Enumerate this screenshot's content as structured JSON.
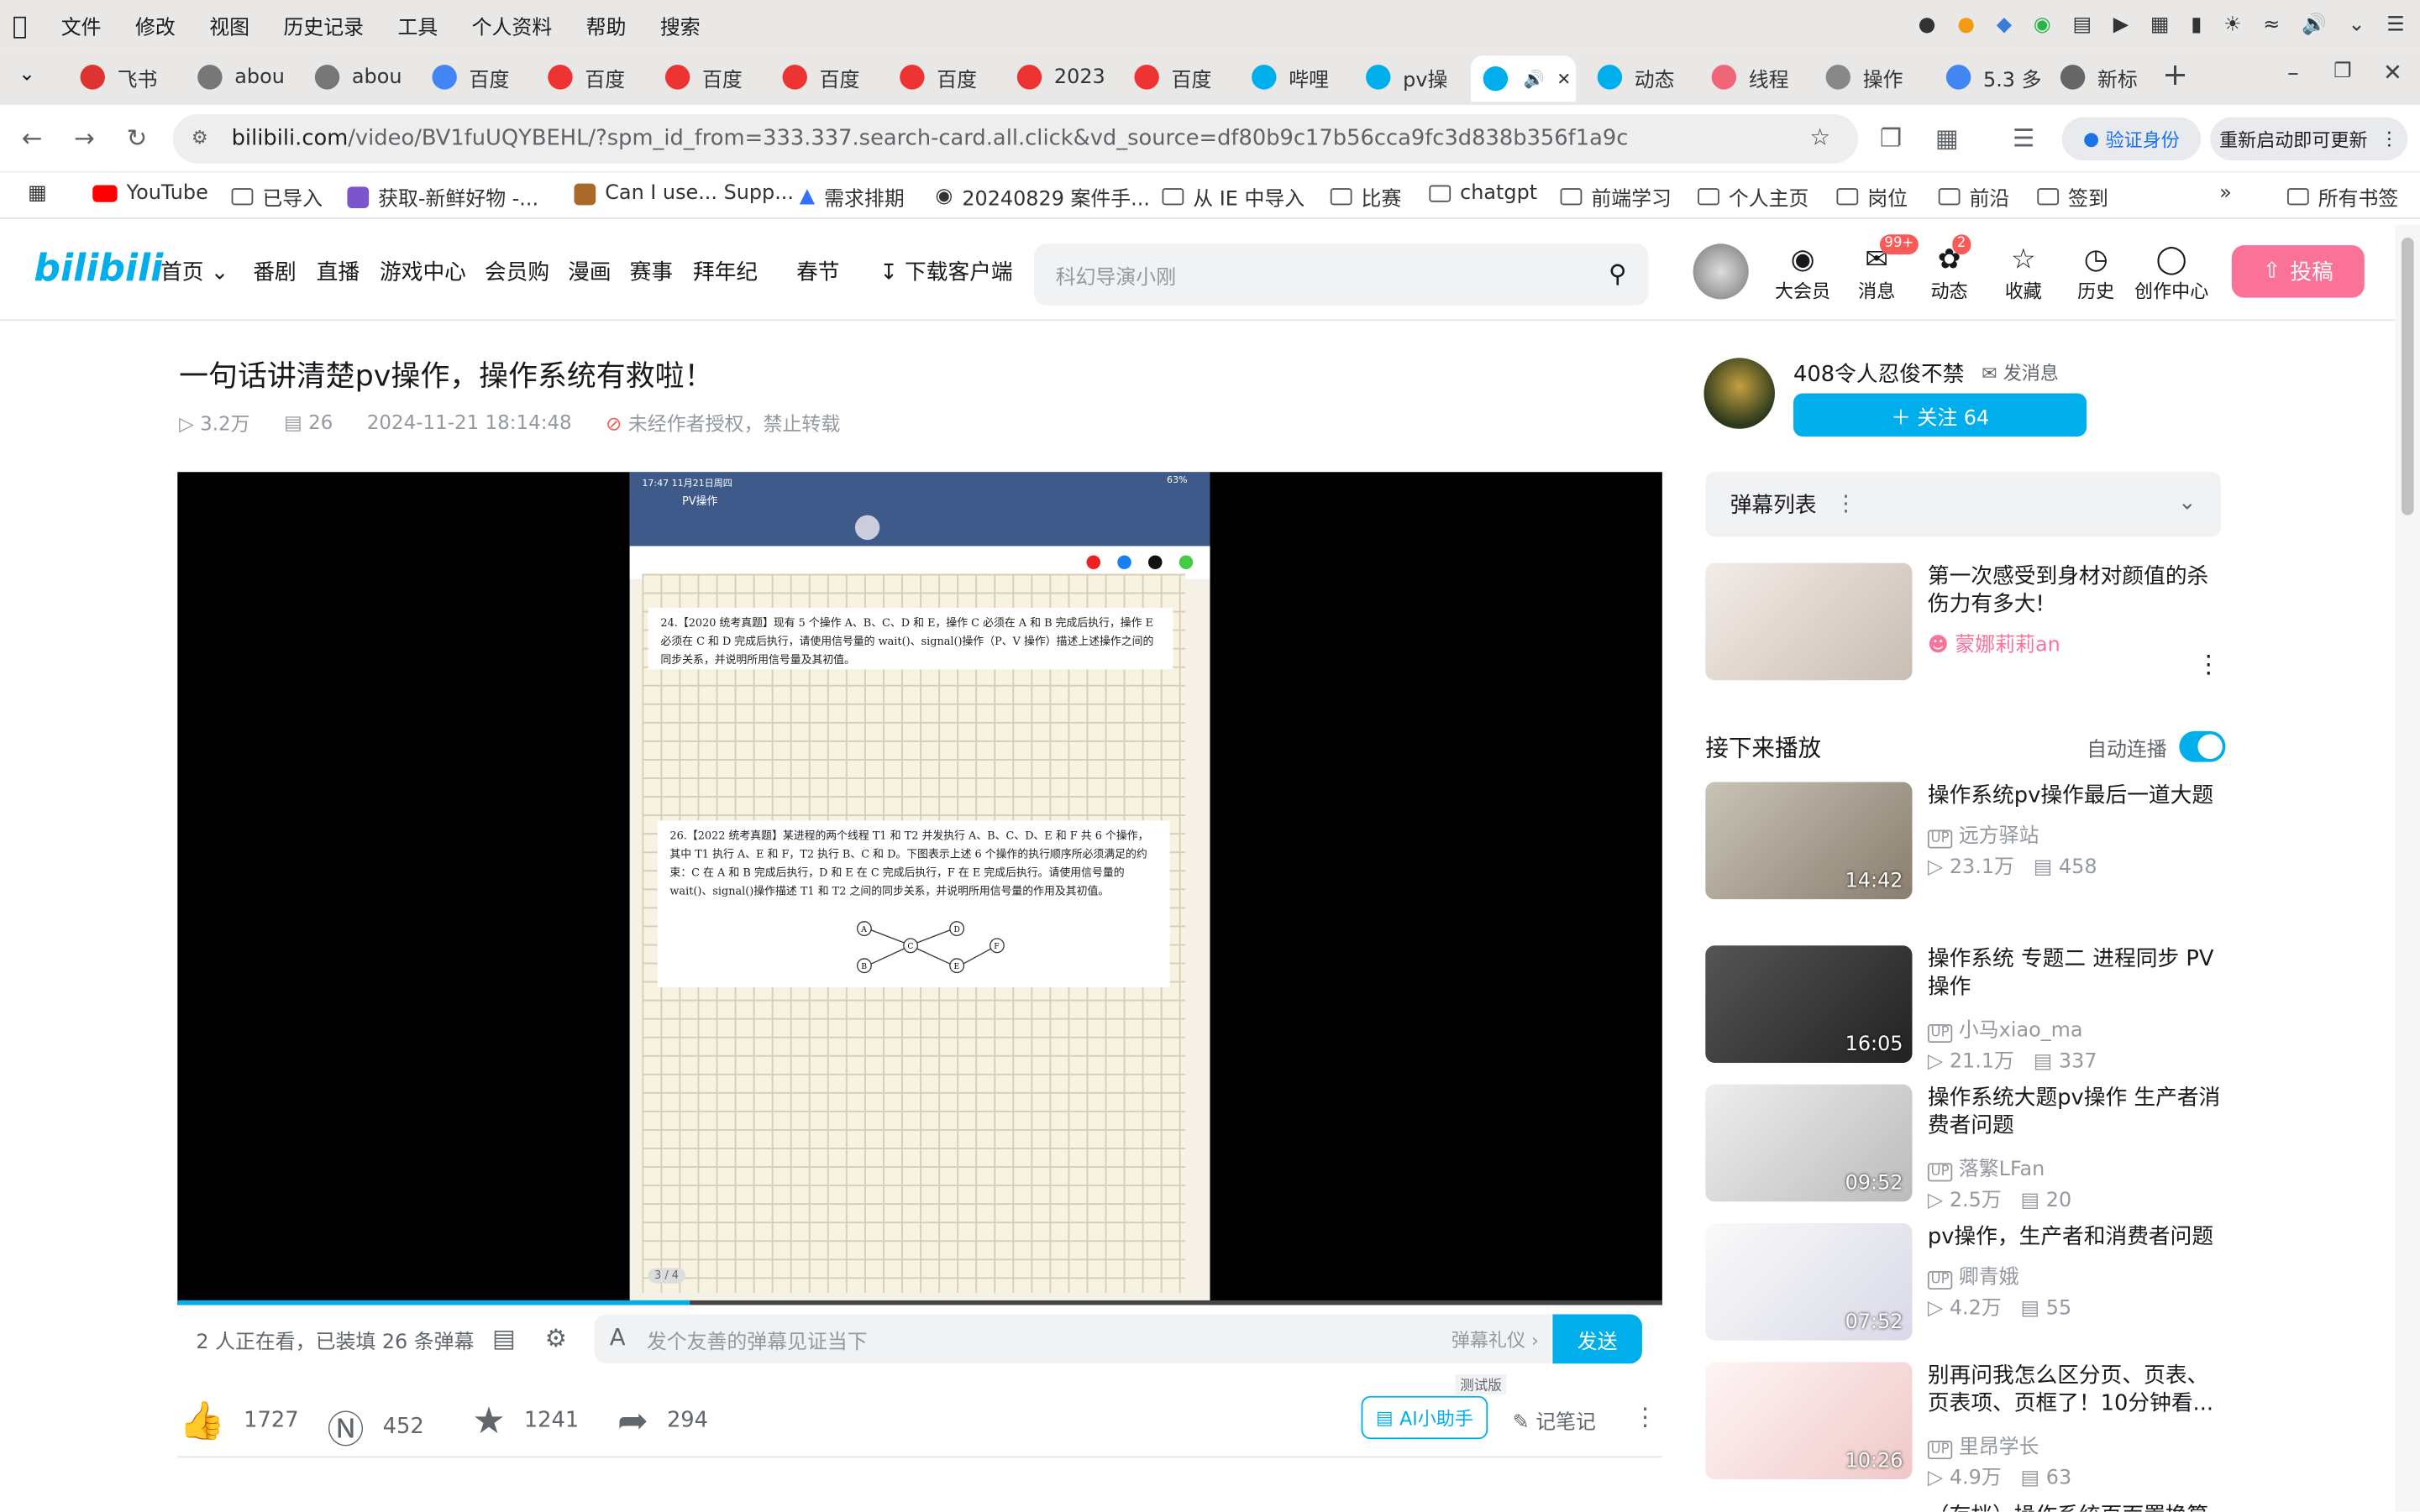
{
  "mac": {
    "menu": [
      "文件",
      "修改",
      "视图",
      "历史记录",
      "工具",
      "个人资料",
      "帮助",
      "搜索"
    ]
  },
  "tabs": [
    {
      "label": "飞书",
      "color": "#d33"
    },
    {
      "label": "abou",
      "color": "#777"
    },
    {
      "label": "abou",
      "color": "#777"
    },
    {
      "label": "百度",
      "color": "#4285f4"
    },
    {
      "label": "百度",
      "color": "#e33"
    },
    {
      "label": "百度",
      "color": "#e33"
    },
    {
      "label": "百度",
      "color": "#e33"
    },
    {
      "label": "百度",
      "color": "#e33"
    },
    {
      "label": "2023",
      "color": "#e33"
    },
    {
      "label": "百度",
      "color": "#e33"
    },
    {
      "label": "哔哩",
      "color": "#00aeec"
    },
    {
      "label": "pv操",
      "color": "#00aeec"
    },
    {
      "label": "",
      "color": "#00aeec"
    },
    {
      "label": "动态",
      "color": "#00aeec"
    },
    {
      "label": "线程",
      "color": "#e67"
    },
    {
      "label": "操作",
      "color": "#888"
    },
    {
      "label": "5.3 多",
      "color": "#4285f4"
    },
    {
      "label": "新标",
      "color": "#666"
    }
  ],
  "address": {
    "domain": "bilibili.com",
    "path": "/video/BV1fuUQYBEHL/?spm_id_from=333.337.search-card.all.click&vd_source=df80b9c17b56cca9fc3d838b356f1a9c",
    "verify": "验证身份",
    "relaunch": "重新启动即可更新"
  },
  "bookmarks": [
    "YouTube",
    "已导入",
    "获取-新鲜好物 -...",
    "Can I use... Supp...",
    "需求排期",
    "20240829 案件手...",
    "从 IE 中导入",
    "比赛",
    "chatgpt",
    "前端学习",
    "个人主页",
    "岗位",
    "前沿",
    "签到",
    "所有书签"
  ],
  "header": {
    "nav": [
      "首页",
      "番剧",
      "直播",
      "游戏中心",
      "会员购",
      "漫画",
      "赛事",
      "拜年纪",
      "春节",
      "下载客户端"
    ],
    "search_placeholder": "科幻导演小刚",
    "icons": [
      "大会员",
      "消息",
      "动态",
      "收藏",
      "历史",
      "创作中心"
    ],
    "msg_badge": "99+",
    "dyn_badge": "2",
    "upload": "投稿"
  },
  "video": {
    "title": "一句话讲清楚pv操作，操作系统有救啦！",
    "views": "3.2万",
    "danmaku": "26",
    "date": "2024-11-21 18:14:48",
    "copyright": "未经作者授权，禁止转载",
    "progress": 0.345
  },
  "ipad": {
    "time": "17:47 11月21日周四",
    "battery": "63%",
    "doc": "PV操作",
    "page": "3 / 4",
    "q24": "24.【2020 统考真题】现有 5 个操作 A、B、C、D 和 E，操作 C 必须在 A 和 B 完成后执行，操作 E 必须在 C 和 D 完成后执行，请使用信号量的 wait()、signal()操作（P、V 操作）描述上述操作之间的同步关系，并说明所用信号量及其初值。",
    "q26": "26.【2022 统考真题】某进程的两个线程 T1 和 T2 并发执行 A、B、C、D、E 和 F 共 6 个操作，其中 T1 执行 A、E 和 F，T2 执行 B、C 和 D。下图表示上述 6 个操作的执行顺序所必须满足的约束：C 在 A 和 B 完成后执行，D 和 E 在 C 完成后执行，F 在 E 完成后执行。请使用信号量的 wait()、signal()操作描述 T1 和 T2 之间的同步关系，并说明所用信号量的作用及其初值。",
    "nodes": [
      "A",
      "B",
      "C",
      "D",
      "E",
      "F"
    ]
  },
  "danmaku_bar": {
    "watching": "2 人正在看，已装填 26 条弹幕",
    "placeholder": "发个友善的弹幕见证当下",
    "etiquette": "弹幕礼仪 ›",
    "send": "发送"
  },
  "actions": {
    "like": "1727",
    "coin": "452",
    "fav": "1241",
    "share": "294",
    "ai": "AI小助手",
    "ai_tag": "测试版",
    "note": "记笔记"
  },
  "uploader": {
    "name": "408令人忍俊不禁",
    "msg": "发消息",
    "follow": "＋ 关注 64"
  },
  "danmaku_list": "弹幕列表",
  "ad": {
    "title": "第一次感受到身材对颜值的杀伤力有多大!",
    "up": "蒙娜莉莉an"
  },
  "next": {
    "label": "接下来播放",
    "autoplay": "自动连播"
  },
  "recs": [
    {
      "title": "操作系统pv操作最后一道大题",
      "up": "远方驿站",
      "views": "23.1万",
      "dm": "458",
      "dur": "14:42"
    },
    {
      "title": "操作系统 专题二 进程同步 PV操作",
      "up": "小马xiao_ma",
      "views": "21.1万",
      "dm": "337",
      "dur": "16:05"
    },
    {
      "title": "操作系统大题pv操作 生产者消费者问题",
      "up": "落繁LFan",
      "views": "2.5万",
      "dm": "20",
      "dur": "09:52"
    },
    {
      "title": "pv操作，生产者和消费者问题",
      "up": "卿青娥",
      "views": "4.2万",
      "dm": "55",
      "dur": "07:52"
    },
    {
      "title": "别再问我怎么区分页、页表、页表项、页框了！10分钟看...",
      "up": "里昂学长",
      "views": "4.9万",
      "dm": "63",
      "dur": "10:26"
    }
  ],
  "last_rec": "（存档）操作系统页面置换算..."
}
